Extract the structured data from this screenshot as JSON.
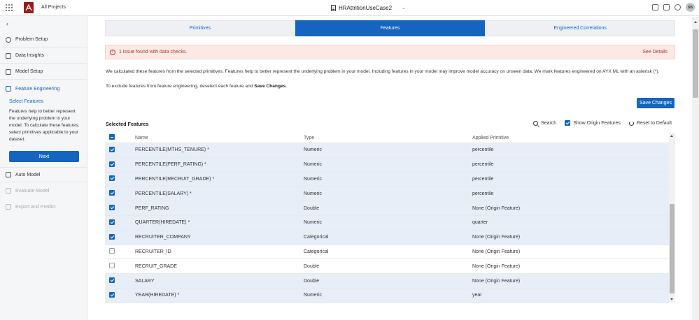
{
  "topbar": {
    "all_projects": "All Projects",
    "project_name": "HRAttritionUseCase2",
    "avatar_initials": "SB"
  },
  "sidebar": {
    "items": [
      {
        "label": "Problem Setup",
        "icon": "clock-icon"
      },
      {
        "label": "Data Insights",
        "icon": "chart-icon"
      },
      {
        "label": "Model Setup",
        "icon": "sliders-icon"
      },
      {
        "label": "Feature Engineering",
        "icon": "layers-icon"
      },
      {
        "label": "Auto Model",
        "icon": "document-icon"
      },
      {
        "label": "Evaluate Model",
        "icon": "monitor-icon"
      },
      {
        "label": "Export and Predict",
        "icon": "download-icon"
      }
    ],
    "sub_title": "Select Features",
    "sub_desc": "Features help to better represent the underlying problem in your model. To calculate these features, select primitives applicable to your dataset.",
    "next_label": "Next"
  },
  "tabs": [
    {
      "label": "Primitives",
      "active": false
    },
    {
      "label": "Features",
      "active": true
    },
    {
      "label": "Engineered Correlations",
      "active": false
    }
  ],
  "alert": {
    "message": "1 issue found with data checks.",
    "link": "See Details"
  },
  "description": {
    "para1": "We calculated these features from the selected primitives. Features help to better represent the underlying problem in your model. Including features in your model may improve model accuracy on unseen data. We mark features engineered on AYX ML with an asterisk (*).",
    "para2_prefix": "To exclude features from feature engineering, deselect each feature and ",
    "para2_bold": "Save Changes",
    "para2_suffix": "."
  },
  "save_changes_label": "Save Changes",
  "selected_features": {
    "title": "Selected Features",
    "search_label": "Search",
    "show_origin_label": "Show Origin Features",
    "show_origin_checked": true,
    "reset_label": "Reset to Default",
    "columns": [
      "Name",
      "Type",
      "Applied Primitive"
    ],
    "rows": [
      {
        "name": "PERCENTILE(MTHS_TENURE) *",
        "type": "Numeric",
        "primitive": "percentile",
        "checked": true
      },
      {
        "name": "PERCENTILE(PERF_RATING) *",
        "type": "Numeric",
        "primitive": "percentile",
        "checked": true
      },
      {
        "name": "PERCENTILE(RECRUIT_GRADE) *",
        "type": "Numeric",
        "primitive": "percentile",
        "checked": true
      },
      {
        "name": "PERCENTILE(SALARY) *",
        "type": "Numeric",
        "primitive": "percentile",
        "checked": true
      },
      {
        "name": "PERF_RATING",
        "type": "Double",
        "primitive": "None (Origin Feature)",
        "checked": true
      },
      {
        "name": "QUARTER(HIREDATE) *",
        "type": "Numeric",
        "primitive": "quarter",
        "checked": true
      },
      {
        "name": "RECRUITER_COMPANY",
        "type": "Categorical",
        "primitive": "None (Origin Feature)",
        "checked": true
      },
      {
        "name": "RECRUITER_ID",
        "type": "Categorical",
        "primitive": "None (Origin Feature)",
        "checked": false
      },
      {
        "name": "RECRUIT_GRADE",
        "type": "Double",
        "primitive": "None (Origin Feature)",
        "checked": false
      },
      {
        "name": "SALARY",
        "type": "Double",
        "primitive": "None (Origin Feature)",
        "checked": true
      },
      {
        "name": "YEAR(HIREDATE) *",
        "type": "Numeric",
        "primitive": "year",
        "checked": true
      }
    ]
  }
}
